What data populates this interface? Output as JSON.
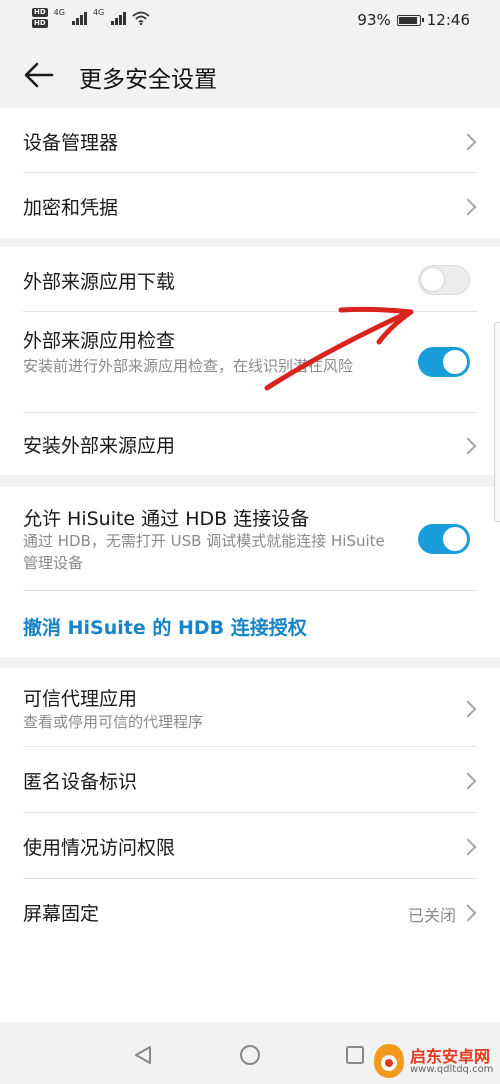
{
  "status_bar": {
    "network_1": "4G",
    "network_2": "4G",
    "hd_badge": "HD",
    "battery_percent": "93%",
    "battery_level": 0.93,
    "time": "12:46"
  },
  "header": {
    "title": "更多安全设置"
  },
  "group1": {
    "device_manager": "设备管理器",
    "encryption_credentials": "加密和凭据"
  },
  "group2": {
    "external_download": {
      "label": "外部来源应用下载",
      "enabled": false
    },
    "external_check": {
      "label": "外部来源应用检查",
      "description": "安装前进行外部来源应用检查，在线识别潜在风险",
      "enabled": true
    },
    "install_external": "安装外部来源应用"
  },
  "group3": {
    "hisuite_hdb": {
      "label": "允许 HiSuite 通过 HDB 连接设备",
      "description": "通过 HDB，无需打开 USB 调试模式就能连接 HiSuite 管理设备",
      "enabled": true
    },
    "revoke_link": "撤消 HiSuite 的 HDB 连接授权"
  },
  "group4": {
    "trust_agents": {
      "label": "可信代理应用",
      "description": "查看或停用可信的代理程序"
    },
    "anonymous_id": "匿名设备标识",
    "usage_access": "使用情况访问权限",
    "screen_pinning": {
      "label": "屏幕固定",
      "value": "已关闭"
    }
  },
  "watermark": {
    "brand": "启东安卓网",
    "url": "www.qdltdq.com"
  },
  "colors": {
    "accent": "#1a9edb",
    "link": "#1784c6",
    "annotation_arrow": "#d8231f",
    "background": "#f2f2f2"
  }
}
